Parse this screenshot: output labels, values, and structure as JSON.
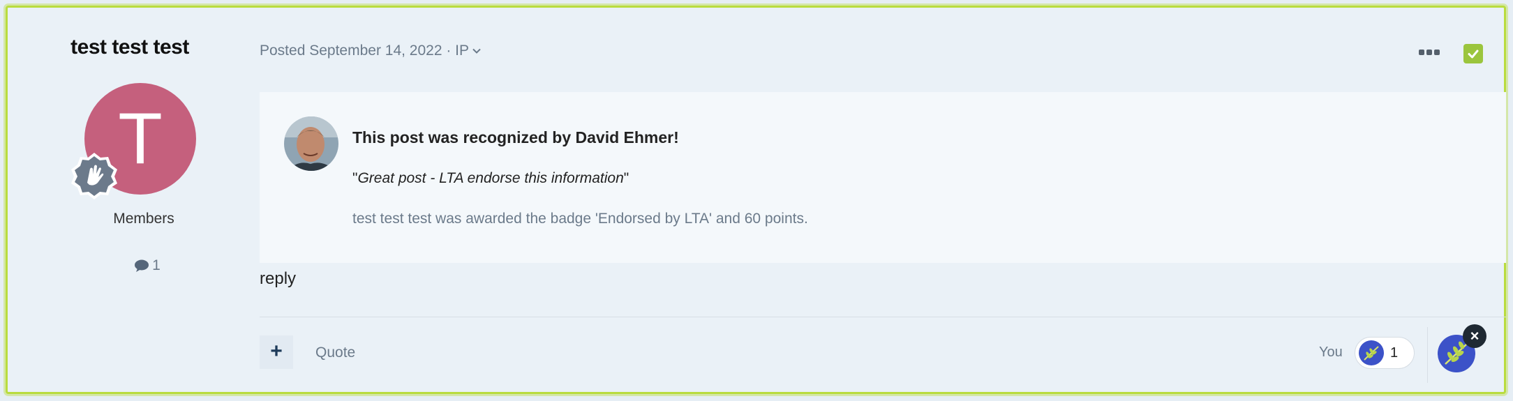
{
  "author": {
    "name": "test test test",
    "avatar_letter": "T",
    "avatar_color": "#c5607d",
    "group": "Members",
    "post_count": "1"
  },
  "post": {
    "meta": "Posted September 14, 2022 · IP",
    "body": "reply"
  },
  "recognition": {
    "title_prefix": "This post was recognized by ",
    "recognizer": "David Ehmer",
    "title_suffix": "!",
    "quote_open": "\"",
    "quote": "Great post - LTA endorse this information",
    "quote_close": "\"",
    "award": "test test test was awarded the badge 'Endorsed by LTA' and 60 points."
  },
  "actions": {
    "plus_label": "+",
    "quote_label": "Quote"
  },
  "reactions": {
    "you_label": "You",
    "count": "1",
    "close_label": "×"
  },
  "icons": [
    "rank-badge-icon",
    "comment-icon",
    "chevron-down-icon",
    "more-icon",
    "checkmark-icon",
    "reaction-icon",
    "close-icon"
  ],
  "colors": {
    "frame_border": "#b9dc3f",
    "check": "#9bc53d",
    "reaction_blue": "#3c52c8"
  }
}
